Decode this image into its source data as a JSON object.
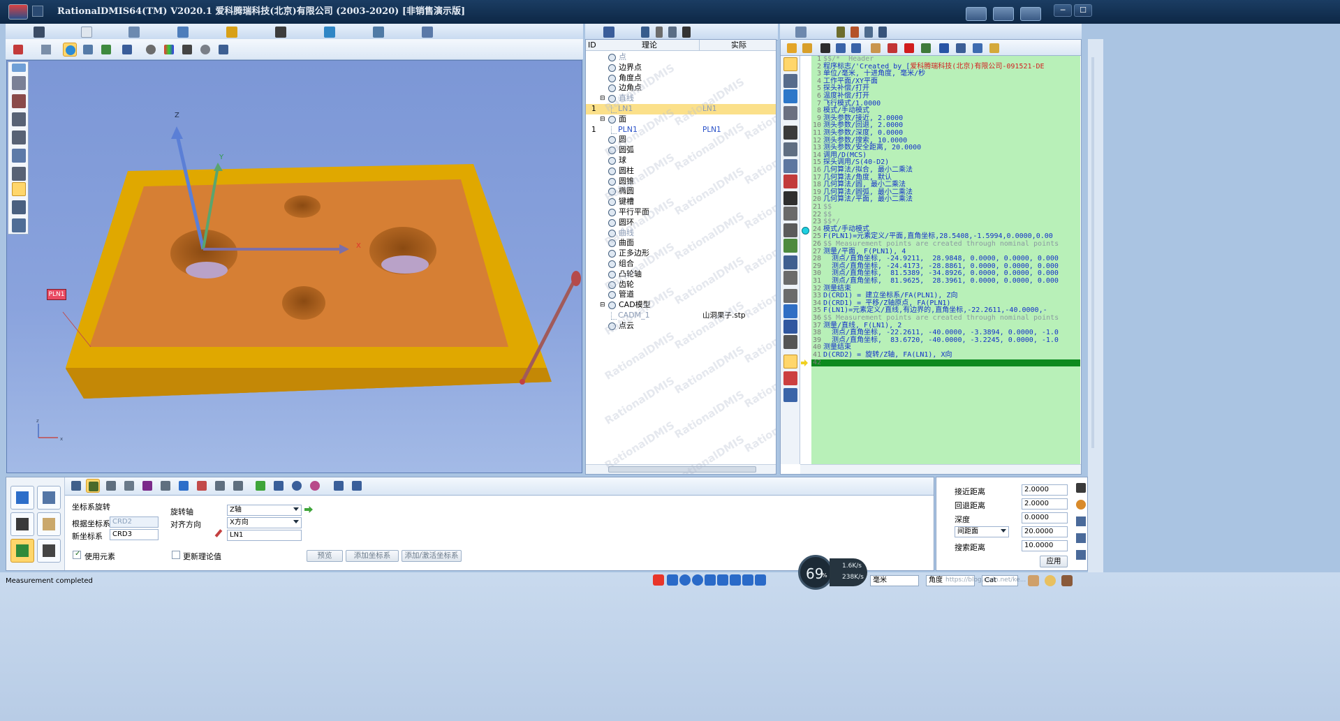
{
  "app": {
    "title": "RationalDMIS64(TM) V2020.1   爱科腾瑞科技(北京)有限公司 (2003-2020) [非销售演示版]"
  },
  "window_controls": {
    "minimize": "─",
    "maximize": "☐",
    "close": "✕"
  },
  "viewport": {
    "axis_labels": {
      "z": "Z",
      "y": "Y",
      "x": "X"
    },
    "feature_label": "PLN1",
    "triad_labels": {
      "z": "z",
      "x": "x"
    }
  },
  "tree": {
    "headers": {
      "id": "ID",
      "nominal": "理论",
      "actual": "实际"
    },
    "rows": [
      {
        "label": "点",
        "id": "",
        "actual": "",
        "muted": true
      },
      {
        "label": "边界点",
        "id": "",
        "actual": ""
      },
      {
        "label": "角度点",
        "id": "",
        "actual": ""
      },
      {
        "label": "边角点",
        "id": "",
        "actual": ""
      },
      {
        "label": "直线",
        "id": "",
        "actual": "",
        "expander": "⊟",
        "muted": true
      },
      {
        "label": "LN1",
        "id": "1",
        "actual": "LN1",
        "child": true,
        "selected": true
      },
      {
        "label": "面",
        "id": "",
        "actual": "",
        "expander": "⊟"
      },
      {
        "label": "PLN1",
        "id": "1",
        "actual": "PLN1",
        "child": true,
        "link": true
      },
      {
        "label": "圆",
        "id": "",
        "actual": ""
      },
      {
        "label": "圆弧",
        "id": "",
        "actual": ""
      },
      {
        "label": "球",
        "id": "",
        "actual": ""
      },
      {
        "label": "圆柱",
        "id": "",
        "actual": ""
      },
      {
        "label": "圆锥",
        "id": "",
        "actual": ""
      },
      {
        "label": "椭圆",
        "id": "",
        "actual": ""
      },
      {
        "label": "键槽",
        "id": "",
        "actual": ""
      },
      {
        "label": "平行平面",
        "id": "",
        "actual": ""
      },
      {
        "label": "圆环",
        "id": "",
        "actual": ""
      },
      {
        "label": "曲线",
        "id": "",
        "actual": "",
        "muted": true
      },
      {
        "label": "曲面",
        "id": "",
        "actual": ""
      },
      {
        "label": "正多边形",
        "id": "",
        "actual": ""
      },
      {
        "label": "组合",
        "id": "",
        "actual": ""
      },
      {
        "label": "凸轮轴",
        "id": "",
        "actual": ""
      },
      {
        "label": "齿轮",
        "id": "",
        "actual": ""
      },
      {
        "label": "管道",
        "id": "",
        "actual": ""
      },
      {
        "label": "CAD模型",
        "id": "",
        "actual": "",
        "expander": "⊟"
      },
      {
        "label": "CADM_1",
        "id": "",
        "actual": "山洞果子.stp",
        "child": true
      },
      {
        "label": "点云",
        "id": "",
        "actual": ""
      }
    ],
    "watermark": "RationalDMIS"
  },
  "code": {
    "lines": [
      {
        "n": "1",
        "t": "$$/*  Header",
        "kind": "hdr"
      },
      {
        "n": "2",
        "t": "程序标志/'Created by [",
        "red": "爱科腾瑞科技(北京)有限公司-091521-DE"
      },
      {
        "n": "3",
        "t": "单位/毫米, 十进角度, 毫米/秒"
      },
      {
        "n": "4",
        "t": "工作平面/XY平面"
      },
      {
        "n": "5",
        "t": "探头补偿/打开"
      },
      {
        "n": "6",
        "t": "温度补偿/打开"
      },
      {
        "n": "7",
        "t": "飞行模式/1.0000"
      },
      {
        "n": "8",
        "t": "模式/手动模式"
      },
      {
        "n": "9",
        "t": "测头参数/接近, 2.0000"
      },
      {
        "n": "10",
        "t": "测头参数/回退, 2.0000"
      },
      {
        "n": "11",
        "t": "测头参数/深度, 0.0000"
      },
      {
        "n": "12",
        "t": "测头参数/搜索, 10.0000"
      },
      {
        "n": "13",
        "t": "测头参数/安全距离, 20.0000"
      },
      {
        "n": "14",
        "t": "调用/D(MCS)"
      },
      {
        "n": "15",
        "t": "探头调用/S(40-D2)"
      },
      {
        "n": "16",
        "t": "几何算法/拟合, 最小二乘法"
      },
      {
        "n": "17",
        "t": "几何算法/角度, 默认"
      },
      {
        "n": "18",
        "t": "几何算法/圆, 最小二乘法"
      },
      {
        "n": "19",
        "t": "几何算法/圆弧, 最小二乘法"
      },
      {
        "n": "20",
        "t": "几何算法/平面, 最小二乘法"
      },
      {
        "n": "21",
        "t": "$$",
        "kind": "cm"
      },
      {
        "n": "22",
        "t": "$$",
        "kind": "cm"
      },
      {
        "n": "23",
        "t": "$$*/",
        "kind": "cm"
      },
      {
        "n": "24",
        "t": "模式/手动模式"
      },
      {
        "n": "25",
        "t": "F(PLN1)=元素定义/平面,直角坐标,28.5408,-1.5994,0.0000,0.00"
      },
      {
        "n": "26",
        "t": "$$ Measurement points are created through nominal points",
        "kind": "cm"
      },
      {
        "n": "27",
        "t": "测量/平面, F(PLN1), 4"
      },
      {
        "n": "28",
        "t": "  测点/直角坐标, -24.9211,  28.9848, 0.0000, 0.0000, 0.000"
      },
      {
        "n": "29",
        "t": "  测点/直角坐标, -24.4173, -28.8861, 0.0000, 0.0000, 0.000"
      },
      {
        "n": "30",
        "t": "  测点/直角坐标,  81.5389, -34.8926, 0.0000, 0.0000, 0.000"
      },
      {
        "n": "31",
        "t": "  测点/直角坐标,  81.9625,  28.3961, 0.0000, 0.0000, 0.000"
      },
      {
        "n": "32",
        "t": "测量结束"
      },
      {
        "n": "33",
        "t": "D(CRD1) = 建立坐标系/FA(PLN1), Z向"
      },
      {
        "n": "34",
        "t": "D(CRD1) = 平移/Z轴原点, FA(PLN1)"
      },
      {
        "n": "35",
        "t": "F(LN1)=元素定义/直线,有边界的,直角坐标,-22.2611,-40.0000,-"
      },
      {
        "n": "36",
        "t": "$$ Measurement points are created through nominal points",
        "kind": "cm"
      },
      {
        "n": "37",
        "t": "测量/直线, F(LN1), 2"
      },
      {
        "n": "38",
        "t": "  测点/直角坐标, -22.2611, -40.0000, -3.3894, 0.0000, -1.0"
      },
      {
        "n": "39",
        "t": "  测点/直角坐标,  83.6720, -40.0000, -3.2245, 0.0000, -1.0"
      },
      {
        "n": "40",
        "t": "测量结束"
      },
      {
        "n": "41",
        "t": "D(CRD2) = 旋转/Z轴, FA(LN1), X向"
      },
      {
        "n": "42",
        "t": "",
        "kind": "cur"
      }
    ]
  },
  "bottom": {
    "section_title": "坐标系旋转",
    "base_label": "根据坐标系",
    "base_value": "CRD2",
    "new_label": "新坐标系",
    "new_value": "CRD3",
    "use_element_label": "使用元素",
    "axis_label": "旋转轴",
    "axis_value": "Z轴",
    "align_label": "对齐方向",
    "align_value": "X方向",
    "element_value": "LN1",
    "update_label": "更新理论值",
    "preview_btn": "预览",
    "add_btn": "添加坐标系",
    "add_activate_btn": "添加/激活坐标系"
  },
  "params": {
    "approach_label": "接近距离",
    "approach_value": "2.0000",
    "retract_label": "回退距离",
    "retract_value": "2.0000",
    "depth_label": "深度",
    "depth_value": "0.0000",
    "clearance_label": "间距面",
    "clearance_value": "20.0000",
    "search_label": "搜索距离",
    "search_value": "10.0000",
    "apply_btn": "应用"
  },
  "status": {
    "message": "Measurement completed",
    "gauge": "69",
    "gauge_unit": "%",
    "up": "1.6K/s",
    "down": "238K/s",
    "unit_combo": "毫米",
    "angle_combo": "角度",
    "coord_combo": "Cat",
    "url": "https://blog.csdn.net/ke..."
  }
}
